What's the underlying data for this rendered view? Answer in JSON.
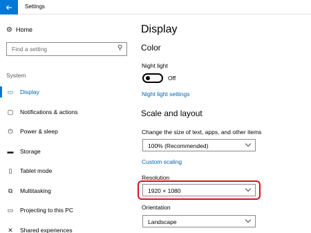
{
  "window": {
    "title": "Settings",
    "back_icon": "back-arrow-icon"
  },
  "sidebar": {
    "home_label": "Home",
    "home_icon": "gear-icon",
    "search_placeholder": "Find a setting",
    "search_icon": "search-icon",
    "section": "System",
    "items": [
      {
        "label": "Display",
        "icon": "monitor-icon",
        "active": true
      },
      {
        "label": "Notifications & actions",
        "icon": "message-icon",
        "active": false
      },
      {
        "label": "Power & sleep",
        "icon": "power-icon",
        "active": false
      },
      {
        "label": "Storage",
        "icon": "storage-icon",
        "active": false
      },
      {
        "label": "Tablet mode",
        "icon": "tablet-icon",
        "active": false
      },
      {
        "label": "Multitasking",
        "icon": "multitasking-icon",
        "active": false
      },
      {
        "label": "Projecting to this PC",
        "icon": "projector-icon",
        "active": false
      },
      {
        "label": "Shared experiences",
        "icon": "shared-experiences-icon",
        "active": false
      }
    ]
  },
  "main": {
    "title": "Display",
    "color_heading": "Color",
    "night_light_label": "Night light",
    "night_light_state": "Off",
    "night_light_settings_link": "Night light settings",
    "scale_heading": "Scale and layout",
    "scale_label": "Change the size of text, apps, and other items",
    "scale_value": "100% (Recommended)",
    "custom_scaling_link": "Custom scaling",
    "resolution_label": "Resolution",
    "resolution_value": "1920 × 1080",
    "orientation_label": "Orientation",
    "orientation_value": "Landscape"
  },
  "colors": {
    "accent": "#0078d7",
    "link": "#0063b1",
    "highlight": "#d6121f"
  }
}
